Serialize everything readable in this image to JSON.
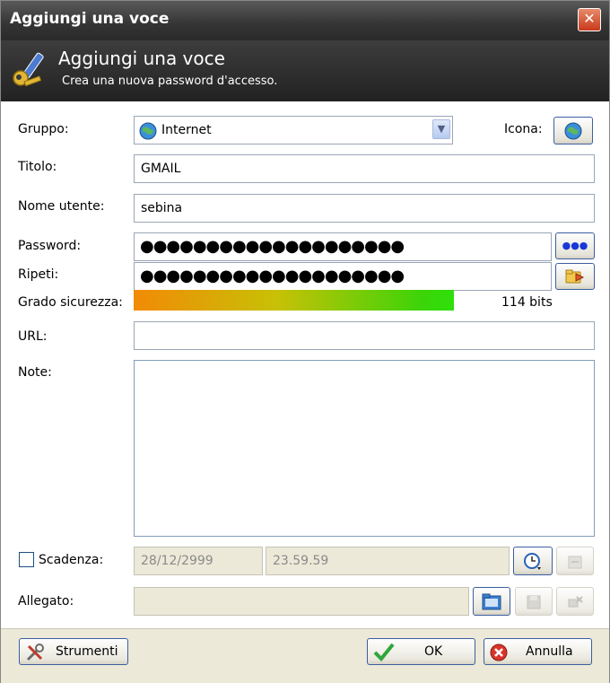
{
  "window": {
    "title": "Aggiungi una voce",
    "close_glyph": "✕"
  },
  "banner": {
    "title": "Aggiungi una voce",
    "subtitle": "Crea una nuova password d'accesso.",
    "icon": "key-pencil-icon"
  },
  "form": {
    "group_label": "Gruppo:",
    "group_value": "Internet",
    "icon_label": "Icona:",
    "title_label": "Titolo:",
    "title_value": "GMAIL",
    "username_label": "Nome utente:",
    "username_value": "sebina",
    "password_label": "Password:",
    "password_value": "●●●●●●●●●●●●●●●●●●●●",
    "repeat_label": "Ripeti:",
    "repeat_value": "●●●●●●●●●●●●●●●●●●●●",
    "reveal_glyph": "●●●",
    "strength_label": "Grado sicurezza:",
    "strength_text": "114 bits",
    "strength_fraction": 0.7,
    "url_label": "URL:",
    "url_value": "",
    "notes_label": "Note:",
    "notes_value": "",
    "expiry_label": "Scadenza:",
    "expiry_checked": false,
    "expiry_date": "28/12/2999",
    "expiry_time": "23.59.59",
    "attachment_label": "Allegato:",
    "attachment_value": ""
  },
  "buttons": {
    "tools": "Strumenti",
    "ok": "OK",
    "cancel": "Annulla"
  },
  "colors": {
    "accent": "#3c5fa0",
    "close": "#c8391c",
    "meter_start": "#f28a06",
    "meter_end": "#2ee00a"
  }
}
